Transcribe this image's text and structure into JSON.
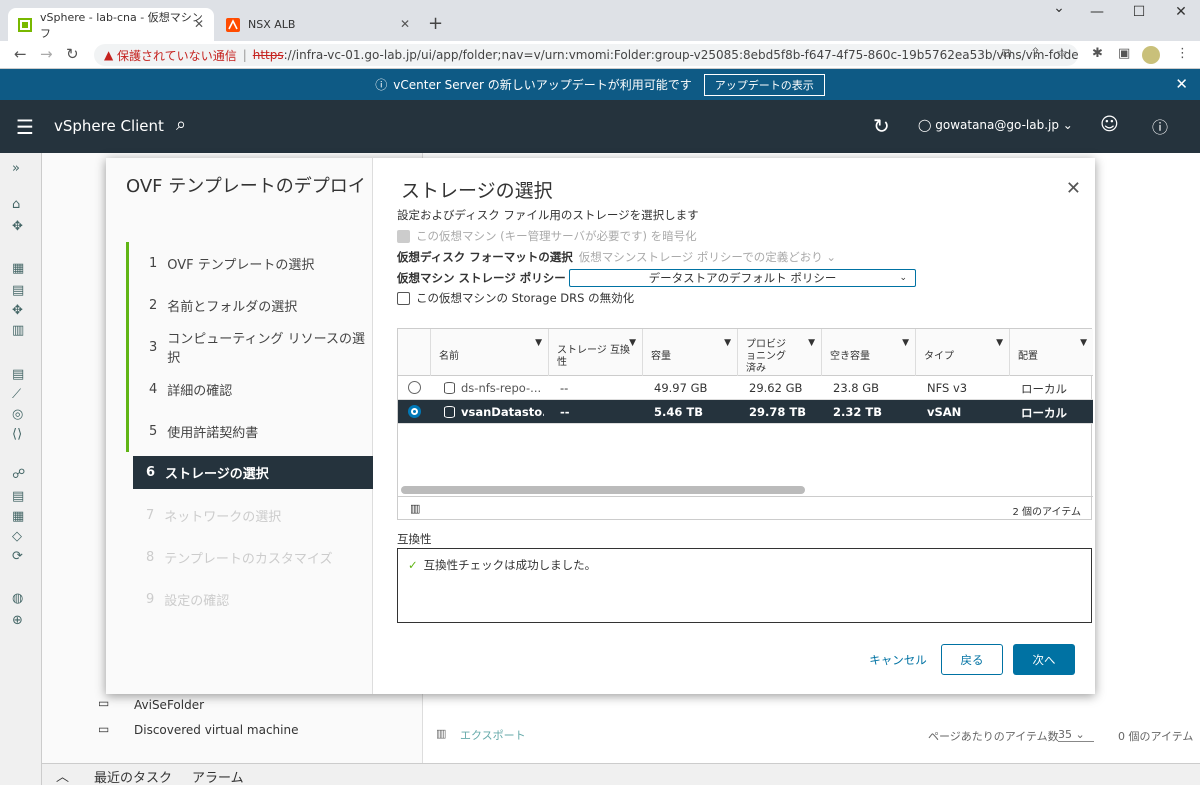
{
  "browser": {
    "tabs": [
      {
        "title": "vSphere - lab-cna - 仮想マシン フ"
      },
      {
        "title": "NSX ALB"
      }
    ],
    "security_label": "保護されていない通信",
    "url_scheme": "https",
    "url_rest": "://infra-vc-01.go-lab.jp/ui/app/folder;nav=v/urn:vmomi:Folder:group-v25085:8ebd5f8b-f647-4f75-860c-19b5762ea53b/vms/vm-folders"
  },
  "banner": {
    "text": "vCenter Server の新しいアップデートが利用可能です",
    "button": "アップデートの表示"
  },
  "header": {
    "brand": "vSphere Client",
    "user": "gowatana@go-lab.jp"
  },
  "bg": {
    "tree_items": [
      "AviSeFolder",
      "Discovered virtual machine"
    ],
    "bottom_tabs": [
      "最近のタスク",
      "アラーム"
    ],
    "export": "エクスポート",
    "per_page_label": "ページあたりのアイテム数",
    "per_page": "35",
    "items_count": "0 個のアイテム"
  },
  "wizard": {
    "title": "OVF テンプレートのデプロイ",
    "steps": [
      {
        "num": "1",
        "label": "OVF テンプレートの選択"
      },
      {
        "num": "2",
        "label": "名前とフォルダの選択"
      },
      {
        "num": "3",
        "label": "コンピューティング リソースの選択"
      },
      {
        "num": "4",
        "label": "詳細の確認"
      },
      {
        "num": "5",
        "label": "使用許諾契約書"
      },
      {
        "num": "6",
        "label": "ストレージの選択"
      },
      {
        "num": "7",
        "label": "ネットワークの選択"
      },
      {
        "num": "8",
        "label": "テンプレートのカスタマイズ"
      },
      {
        "num": "9",
        "label": "設定の確認"
      }
    ],
    "page_title": "ストレージの選択",
    "description": "設定およびディスク ファイル用のストレージを選択します",
    "encrypt_label": "この仮想マシン (キー管理サーバが必要です) を暗号化",
    "disk_format_label": "仮想ディスク フォーマットの選択",
    "disk_format_value": "仮想マシンストレージ ポリシーでの定義どおり",
    "policy_label": "仮想マシン ストレージ ポリシー",
    "policy_value": "データストアのデフォルト ポリシー",
    "drs_label": "この仮想マシンの Storage DRS の無効化",
    "grid": {
      "columns": [
        "名前",
        "ストレージ 互換性",
        "容量",
        "プロビジョニング済み",
        "空き容量",
        "タイプ",
        "配置"
      ],
      "rows": [
        {
          "name": "ds-nfs-repo-...",
          "compat": "--",
          "capacity": "49.97 GB",
          "provisioned": "29.62 GB",
          "free": "23.8 GB",
          "type": "NFS v3",
          "placement": "ローカル",
          "selected": false
        },
        {
          "name": "vsanDatasto...",
          "compat": "--",
          "capacity": "5.46 TB",
          "provisioned": "29.78 TB",
          "free": "2.32 TB",
          "type": "vSAN",
          "placement": "ローカル",
          "selected": true
        }
      ],
      "footer_count": "2 個のアイテム"
    },
    "compat_label": "互換性",
    "compat_message": "互換性チェックは成功しました。",
    "buttons": {
      "cancel": "キャンセル",
      "back": "戻る",
      "next": "次へ"
    }
  }
}
